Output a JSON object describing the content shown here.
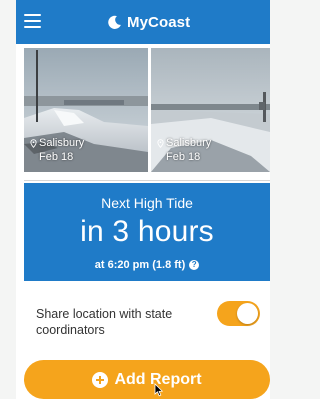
{
  "header": {
    "title": "MyCoast",
    "menu_icon": "hamburger-menu-icon",
    "logo_icon": "crescent-moon-logo-icon",
    "color": "#1f7bc8"
  },
  "photos": [
    {
      "location": "Salisbury",
      "date": "Feb 18",
      "icon": "map-pin-icon"
    },
    {
      "location": "Salisbury",
      "date": "Feb 18",
      "icon": "map-pin-icon"
    }
  ],
  "tide": {
    "title": "Next High Tide",
    "value": "in 3 hours",
    "detail": "at 6:20 pm (1.8 ft)",
    "help_icon": "question-circle-icon",
    "help_symbol": "?"
  },
  "share": {
    "label": "Share location with state coordinators",
    "enabled": true,
    "toggle_color": "#f5a41c"
  },
  "add_report": {
    "label": "Add Report",
    "icon": "plus-circle-icon",
    "color": "#f5a41c"
  }
}
